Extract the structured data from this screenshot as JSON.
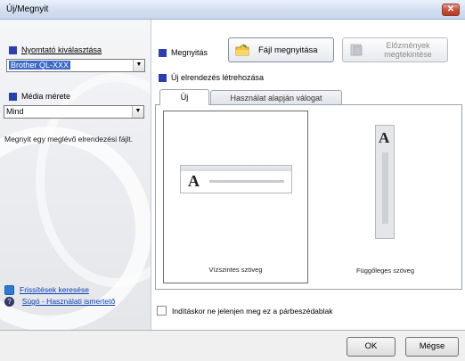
{
  "window": {
    "title": "Új/Megnyit",
    "close_label": "✕"
  },
  "left": {
    "printer_label": "Nyomtató kiválasztása",
    "printer_value": "Brother QL-XXX",
    "media_label": "Média mérete",
    "media_value": "Mind",
    "description": "Megnyit egy meglévő elrendezési fájlt.",
    "links": {
      "update": "Frissítések keresése",
      "help": "Súgó - Használati ismertető"
    }
  },
  "right": {
    "open_option": "Megnyitás",
    "open_file_button": "Fájl megnyitása",
    "history_button": "Előzmények megtekintése",
    "new_layout_option": "Új elrendezés létrehozása",
    "tabs": [
      "Új",
      "Használat alapján válogat"
    ],
    "cards": [
      {
        "label": "Vízszintes szöveg",
        "glyph": "A",
        "selected": true
      },
      {
        "label": "Függőleges szöveg",
        "glyph": "A",
        "selected": false
      }
    ],
    "startup_checkbox": "Indításkor ne jelenjen meg ez a párbeszédablak"
  },
  "footer": {
    "ok": "OK",
    "cancel": "Mégse"
  },
  "colors": {
    "accent_square": "#2c3fb0",
    "link": "#0b3fb5",
    "selection": "#3d69c8"
  },
  "icons": [
    "close-icon",
    "folder-icon",
    "history-icon",
    "update-icon",
    "help-icon",
    "dropdown-arrow-icon"
  ]
}
